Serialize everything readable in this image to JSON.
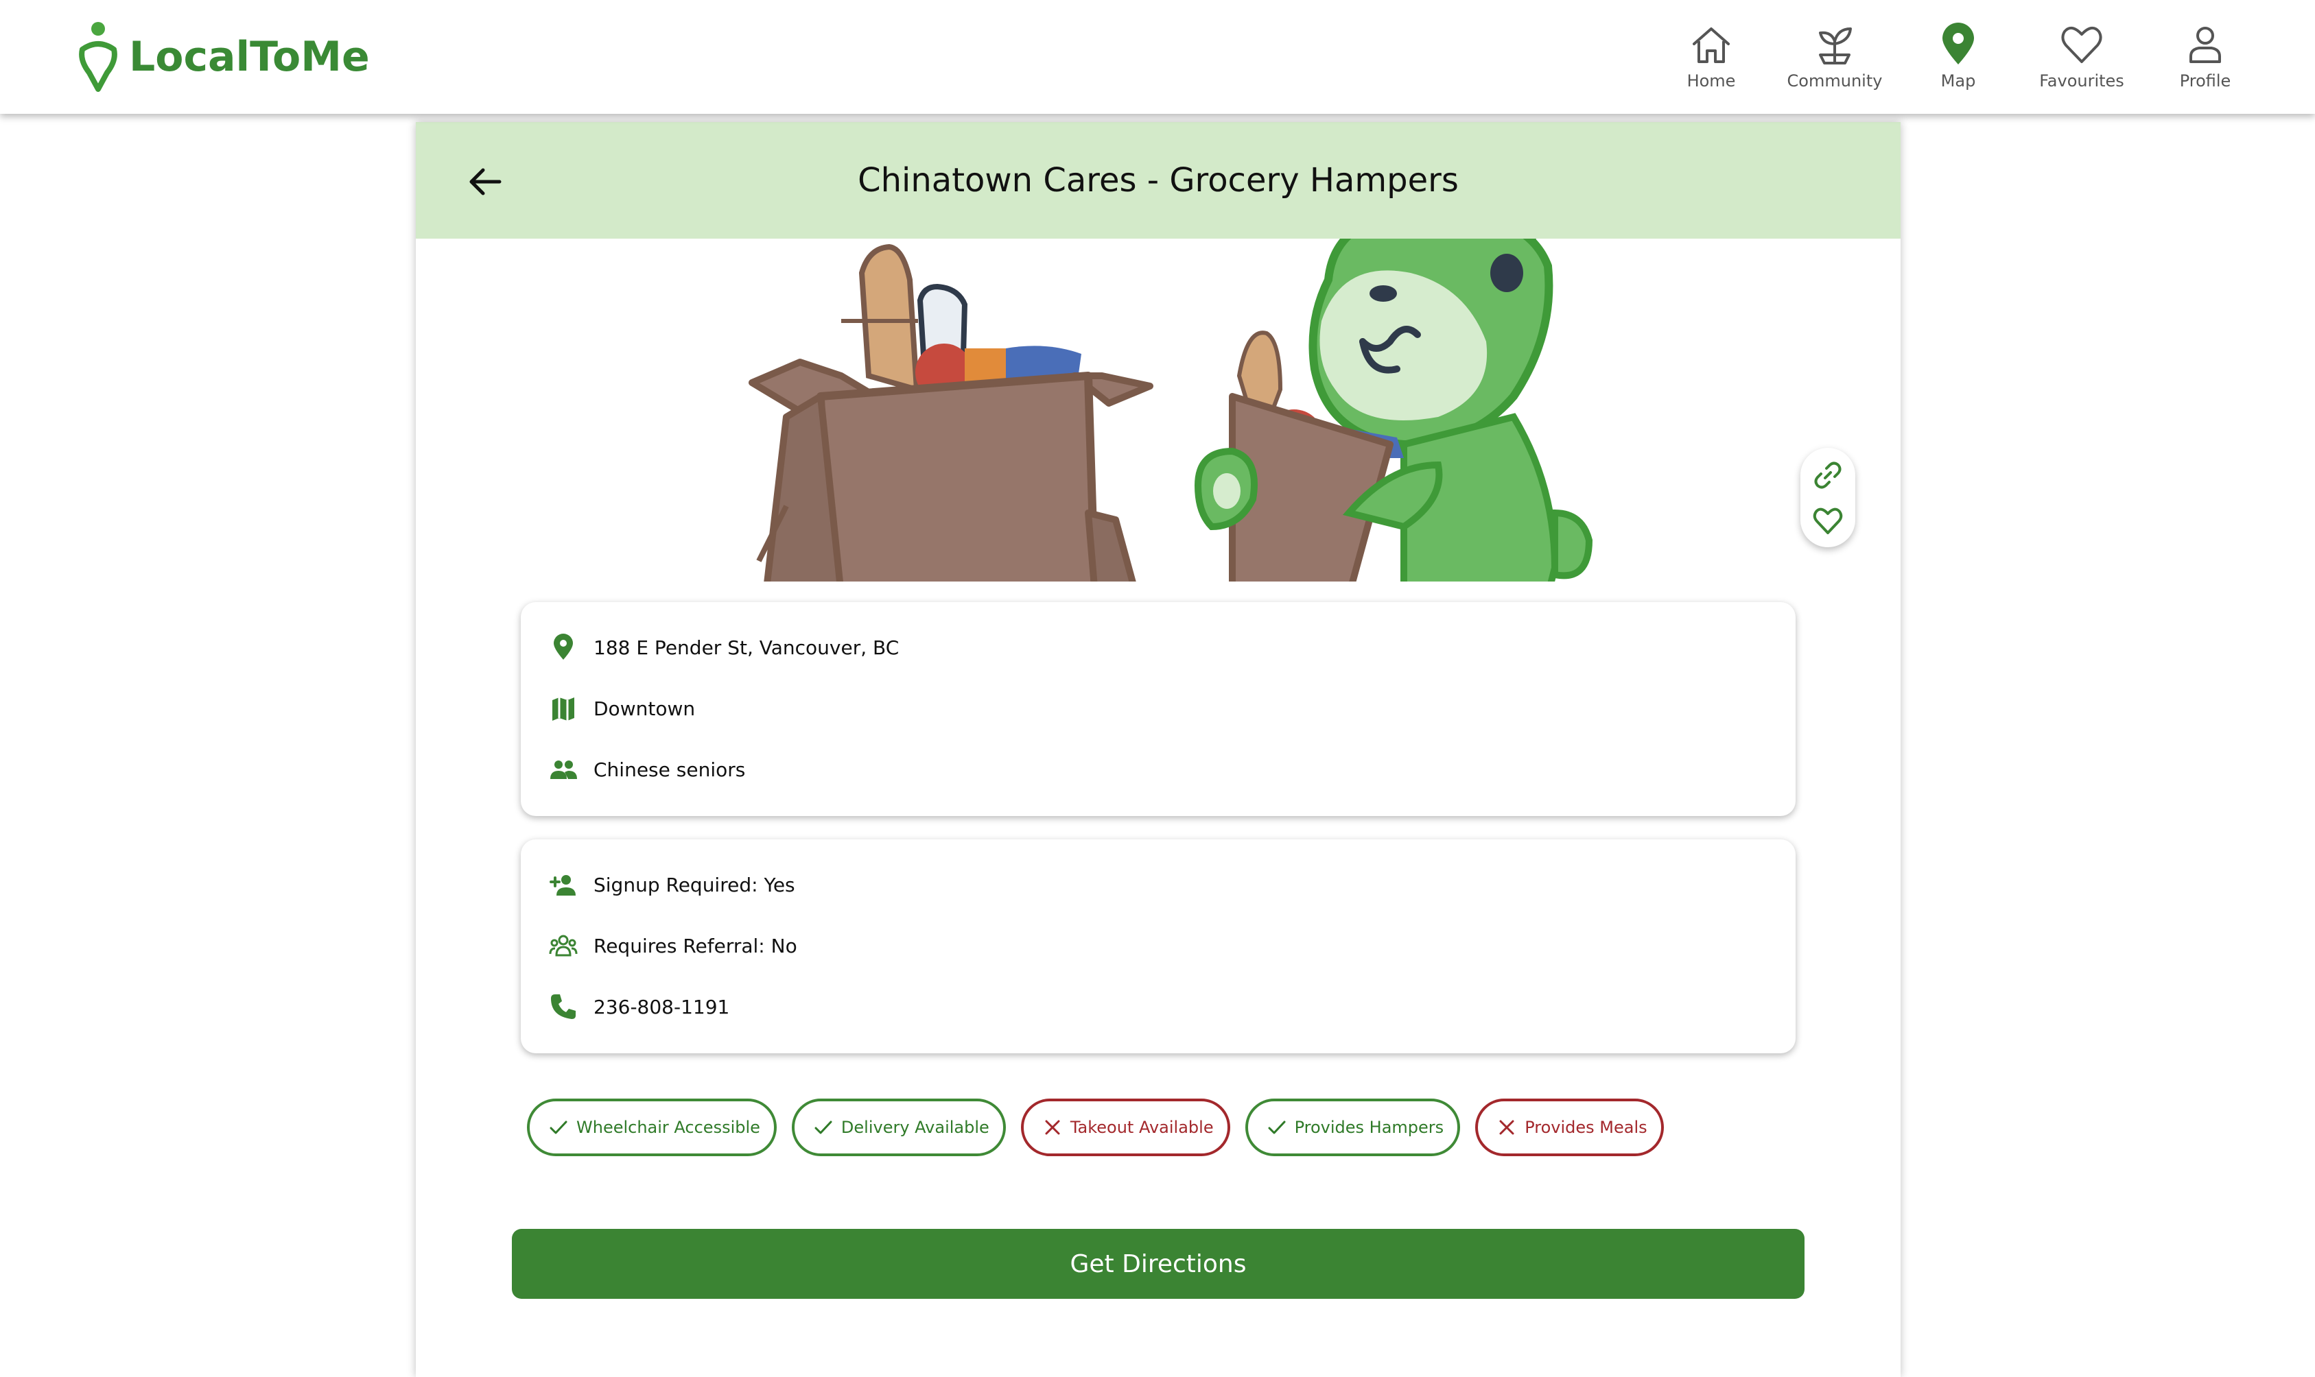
{
  "app": {
    "brand_prefix": "Local",
    "brand_suffix": "ToMe"
  },
  "nav": {
    "items": [
      {
        "label": "Home",
        "icon": "home-icon"
      },
      {
        "label": "Community",
        "icon": "sprout-icon"
      },
      {
        "label": "Map",
        "icon": "map-pin-icon",
        "active": true
      },
      {
        "label": "Favourites",
        "icon": "heart-icon"
      },
      {
        "label": "Profile",
        "icon": "person-icon"
      }
    ]
  },
  "page": {
    "title": "Chinatown Cares - Grocery Hampers"
  },
  "location": {
    "address": "188 E Pender St, Vancouver, BC",
    "area": "Downtown",
    "audience": "Chinese seniors"
  },
  "requirements": {
    "signup": "Signup Required: Yes",
    "referral": "Requires Referral: No",
    "phone": "236-808-1191"
  },
  "features": [
    {
      "label": "Wheelchair Accessible",
      "available": true
    },
    {
      "label": "Delivery Available",
      "available": true
    },
    {
      "label": "Takeout Available",
      "available": false
    },
    {
      "label": "Provides Hampers",
      "available": true
    },
    {
      "label": "Provides Meals",
      "available": false
    }
  ],
  "actions": {
    "directions_label": "Get Directions"
  },
  "colors": {
    "brand_green": "#3b8433",
    "header_bg": "#d3eac9",
    "negative": "#a3282c"
  }
}
